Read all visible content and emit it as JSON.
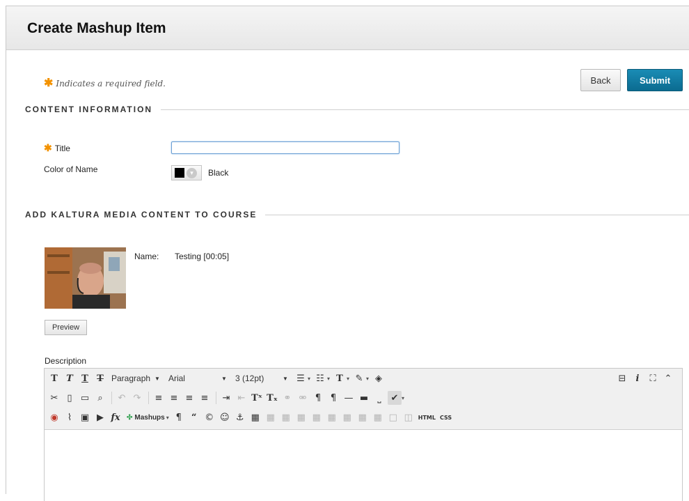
{
  "page": {
    "title": "Create Mashup Item"
  },
  "required_note": "Indicates a required field.",
  "buttons": {
    "back": "Back",
    "submit": "Submit",
    "preview": "Preview"
  },
  "sections": {
    "content_info": "CONTENT INFORMATION",
    "kaltura": "ADD KALTURA MEDIA CONTENT TO COURSE"
  },
  "fields": {
    "title_label": "Title",
    "title_value": "",
    "color_label": "Color of Name",
    "color_value": "Black",
    "description_label": "Description"
  },
  "media": {
    "name_label": "Name:",
    "name_value": "Testing [00:05]"
  },
  "editor": {
    "paragraph": "Paragraph",
    "font": "Arial",
    "size": "3 (12pt)",
    "mashups": "Mashups",
    "html": "HTML",
    "css": "CSS"
  },
  "colors": {
    "accent": "#f39200",
    "submit_bg": "#0b6b90"
  }
}
